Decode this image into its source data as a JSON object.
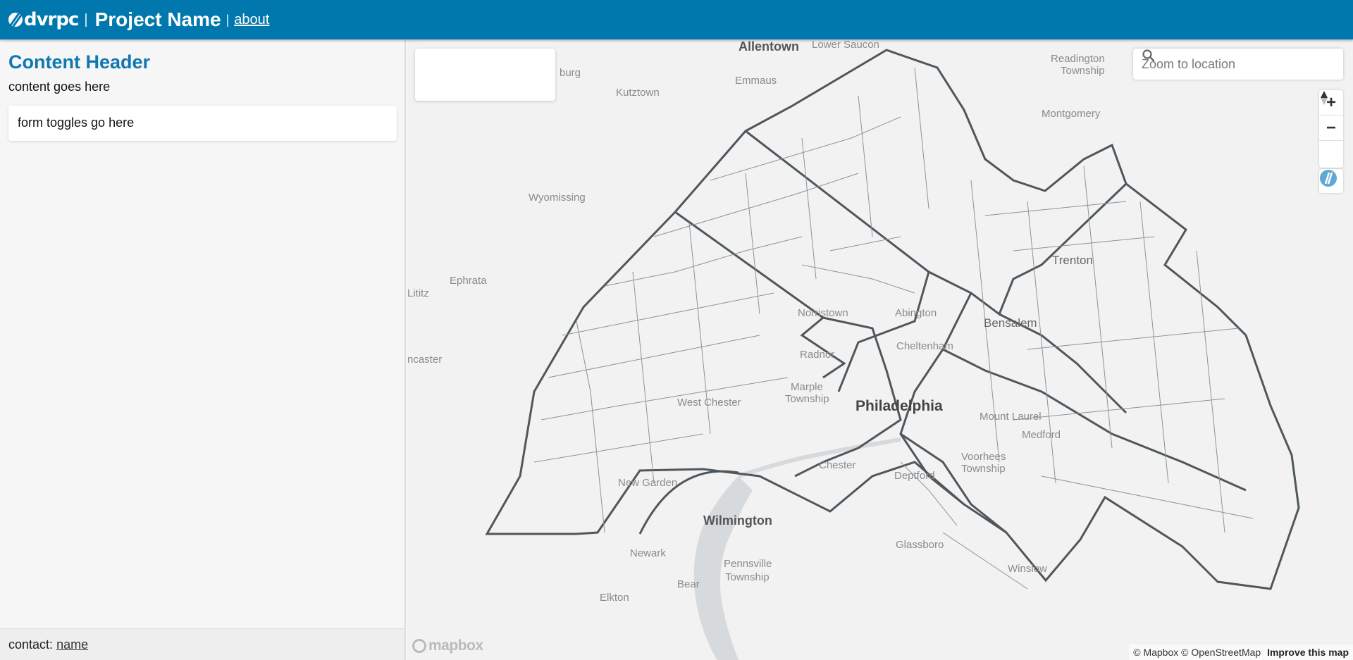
{
  "header": {
    "logo_text": "dvrpc",
    "separator": "|",
    "project_name": "Project Name",
    "about_label": "about"
  },
  "sidebar": {
    "content_header": "Content Header",
    "content_text": "content goes here",
    "form_text": "form toggles go here",
    "footer_label": "contact:",
    "footer_link": "name"
  },
  "map": {
    "search": {
      "placeholder": "Zoom to location"
    },
    "controls": {
      "zoom_in": "+",
      "zoom_out": "−"
    },
    "mapbox_logo": "mapbox",
    "attribution": {
      "mapbox": "© Mapbox",
      "osm": "© OpenStreetMap",
      "improve": "Improve this map"
    },
    "places": {
      "allentown": "Allentown",
      "lower_saucon": "Lower Saucon",
      "emmaus": "Emmaus",
      "kutztown": "Kutztown",
      "burg": "burg",
      "readington": "Readington",
      "township": "Township",
      "montgomery": "Montgomery",
      "wyomissing": "Wyomissing",
      "trenton": "Trenton",
      "ephrata": "Ephrata",
      "lititz": "Lititz",
      "norristown": "Norristown",
      "abington": "Abington",
      "bensalem": "Bensalem",
      "cheltenham": "Cheltenham",
      "radnor": "Radnor",
      "ncaster": "ncaster",
      "marple": "Marple",
      "marple_twp": "Township",
      "west_chester": "West Chester",
      "philadelphia": "Philadelphia",
      "mount_laurel": "Mount Laurel",
      "medford": "Medford",
      "voorhees": "Voorhees",
      "voorhees_twp": "Township",
      "deptford": "Deptford",
      "chester": "Chester",
      "new_garden": "New Garden",
      "wilmington": "Wilmington",
      "newark": "Newark",
      "pennsville": "Pennsville",
      "pennsville_twp": "Township",
      "bear": "Bear",
      "glassboro": "Glassboro",
      "winslow": "Winslow",
      "elkton": "Elkton"
    },
    "colors": {
      "boundary": "#4f575d",
      "muni": "#8d9398",
      "water": "#d6dadd"
    }
  }
}
